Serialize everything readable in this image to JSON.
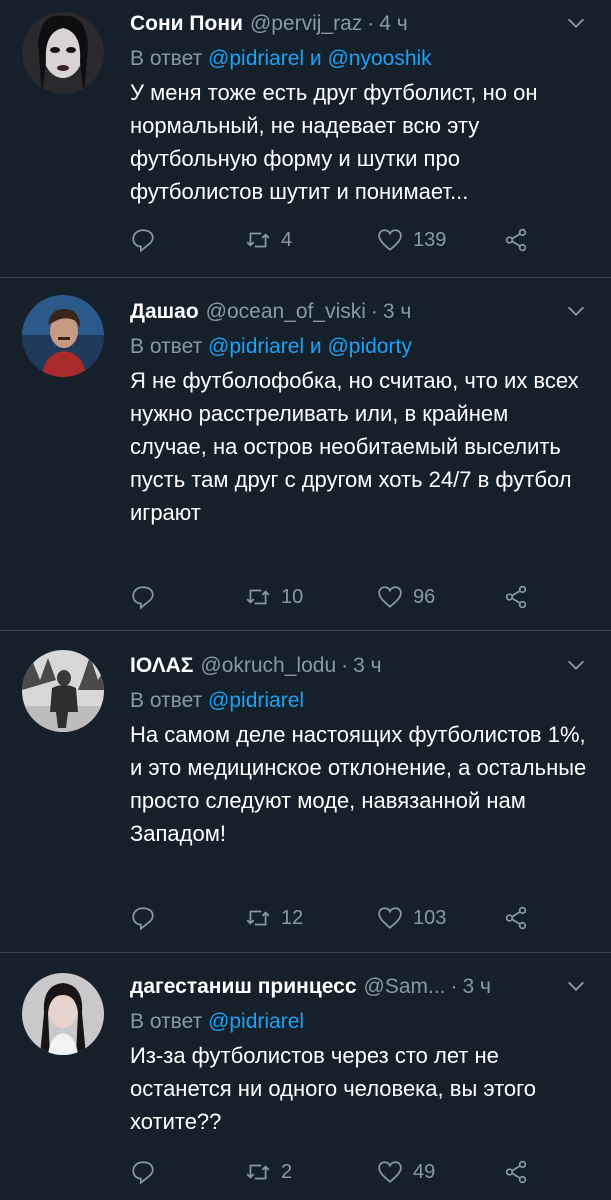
{
  "tweets": [
    {
      "name": "Сони Пони",
      "handle": "@pervij_raz",
      "time": "4 ч",
      "reply_prefix": "В ответ",
      "mentions": "@pidriarel и @nyooshik",
      "text": "У меня тоже есть друг футболист, но он нормальный, не надевает всю эту футбольную форму и шутки про футболистов шутит и понимает...",
      "retweets": "4",
      "likes": "139"
    },
    {
      "name": "Дашао",
      "handle": "@ocean_of_viski",
      "time": "3 ч",
      "reply_prefix": "В ответ",
      "mentions": "@pidriarel и @pidorty",
      "text": "Я не футболофобка, но считаю, что их всех нужно расстреливать или, в крайнем случае, на остров необитаемый выселить пусть там друг с другом хоть 24/7 в футбол играют",
      "retweets": "10",
      "likes": "96"
    },
    {
      "name": "ΙΟΛΑΣ",
      "handle": "@okruch_lodu",
      "time": "3 ч",
      "reply_prefix": "В ответ",
      "mentions": "@pidriarel",
      "text": "На самом деле настоящих футболистов 1%, и это медицинское отклонение, а остальные просто следуют моде, навязанной нам Западом!",
      "retweets": "12",
      "likes": "103"
    },
    {
      "name": "дагестаниш принцесс",
      "handle": "@Sam...",
      "time": "3 ч",
      "reply_prefix": "В ответ",
      "mentions": "@pidriarel",
      "text": "Из-за футболистов через сто лет не останется ни одного человека, вы этого хотите??",
      "retweets": "2",
      "likes": "49"
    }
  ],
  "colors": {
    "background": "#15202b",
    "secondary_text": "#8899a6",
    "link": "#1da1f2",
    "divider": "#38444d"
  }
}
